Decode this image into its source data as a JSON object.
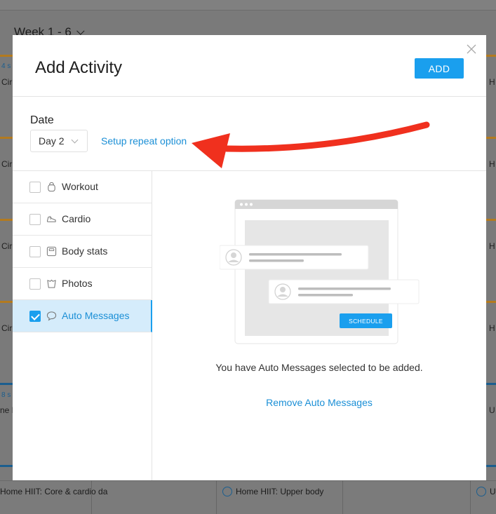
{
  "background": {
    "week_label": "Week 1 - 6",
    "left_cells": [
      "Cir",
      "Cir",
      "Cir",
      "Cir",
      "ne H"
    ],
    "right_cells": [
      "H",
      "H",
      "H",
      "H",
      "U"
    ],
    "mini_labels": [
      "4 s",
      "8 s"
    ],
    "bottom_items": [
      {
        "label": "Home HIIT: Core & cardio da"
      },
      {
        "label": "Home HIIT: Upper body"
      },
      {
        "label": "U"
      }
    ],
    "colors": {
      "orange_stripe": "#b37a1f",
      "blue_stripe": "#1b5e8f"
    }
  },
  "modal": {
    "title": "Add Activity",
    "add_button": "ADD",
    "date_label": "Date",
    "day_value": "Day 2",
    "repeat_link": "Setup repeat option",
    "activities": [
      {
        "label": "Workout",
        "icon": "kettlebell-icon",
        "checked": false
      },
      {
        "label": "Cardio",
        "icon": "shoe-icon",
        "checked": false
      },
      {
        "label": "Body stats",
        "icon": "scale-icon",
        "checked": false
      },
      {
        "label": "Photos",
        "icon": "photo-icon",
        "checked": false
      },
      {
        "label": "Auto Messages",
        "icon": "chat-bubble-icon",
        "checked": true
      }
    ],
    "illustration_button": "SCHEDULE",
    "info_text": "You have Auto Messages selected to be added.",
    "remove_link": "Remove Auto Messages",
    "colors": {
      "accent": "#1a9fee",
      "link": "#1b8fd6",
      "active_bg": "#d5ecfb",
      "arrow": "#f0301e"
    }
  }
}
